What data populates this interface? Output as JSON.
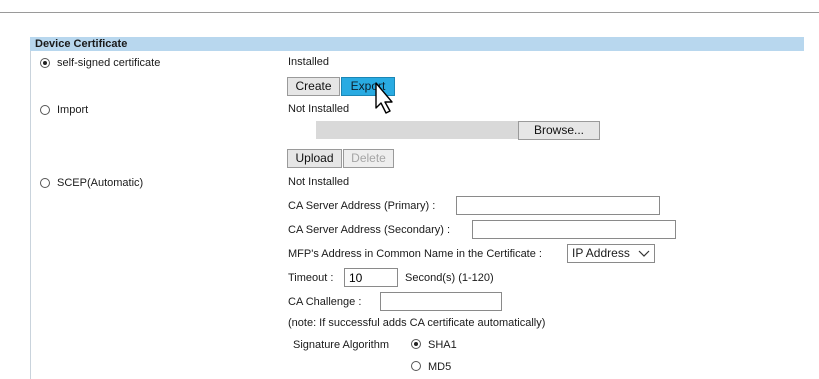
{
  "section": {
    "title": "Device Certificate"
  },
  "self_signed": {
    "label": "self-signed certificate",
    "selected": true,
    "status": "Installed",
    "create_label": "Create",
    "export_label": "Export"
  },
  "import": {
    "label": "Import",
    "selected": false,
    "status": "Not Installed",
    "file_path": "",
    "browse_label": "Browse...",
    "upload_label": "Upload",
    "delete_label": "Delete"
  },
  "scep": {
    "label": "SCEP(Automatic)",
    "selected": false,
    "status": "Not Installed",
    "primary_label": "CA Server Address (Primary)  :",
    "primary_value": "",
    "secondary_label": "CA Server Address (Secondary)  :",
    "secondary_value": "",
    "common_name_label": "MFP's Address in Common Name in the Certificate  :",
    "common_name_value": "IP Address",
    "timeout_label": "Timeout  :",
    "timeout_value": "10",
    "timeout_unit": "Second(s) (1-120)",
    "challenge_label": "CA Challenge  :",
    "challenge_value": "",
    "note": "(note: If successful adds CA certificate automatically)",
    "signature_label": "Signature Algorithm",
    "sha1_label": "SHA1",
    "sha1_selected": true,
    "md5_label": "MD5",
    "md5_selected": false
  }
}
